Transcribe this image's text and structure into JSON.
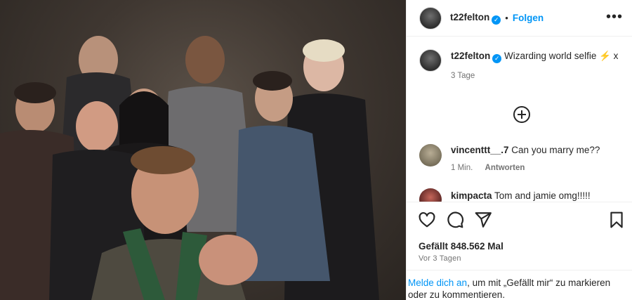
{
  "post": {
    "username": "t22felton",
    "follow_label": "Folgen",
    "more_label": "•••",
    "caption_text": "Wizarding world selfie ⚡️ x",
    "caption_time": "3 Tage"
  },
  "comments": [
    {
      "username": "vincenttt__.7",
      "text": "Can you marry me??",
      "time": "1 Min.",
      "reply_label": "Antworten",
      "avatar_color": "#8a8270"
    },
    {
      "username": "kimpacta",
      "text": "Tom and jamie omg!!!!!",
      "avatar_color": "#6b2a2a"
    }
  ],
  "actions": {
    "likes": "Gefällt 848.562 Mal",
    "posted_ago": "Vor 3 Tagen"
  },
  "login_prompt": {
    "link": "Melde dich an",
    "rest": ", um mit „Gefällt mir“ zu markieren oder zu kommentieren."
  },
  "colors": {
    "accent": "#0095f6",
    "text": "#262626",
    "muted": "#737373",
    "border": "#efefef"
  }
}
